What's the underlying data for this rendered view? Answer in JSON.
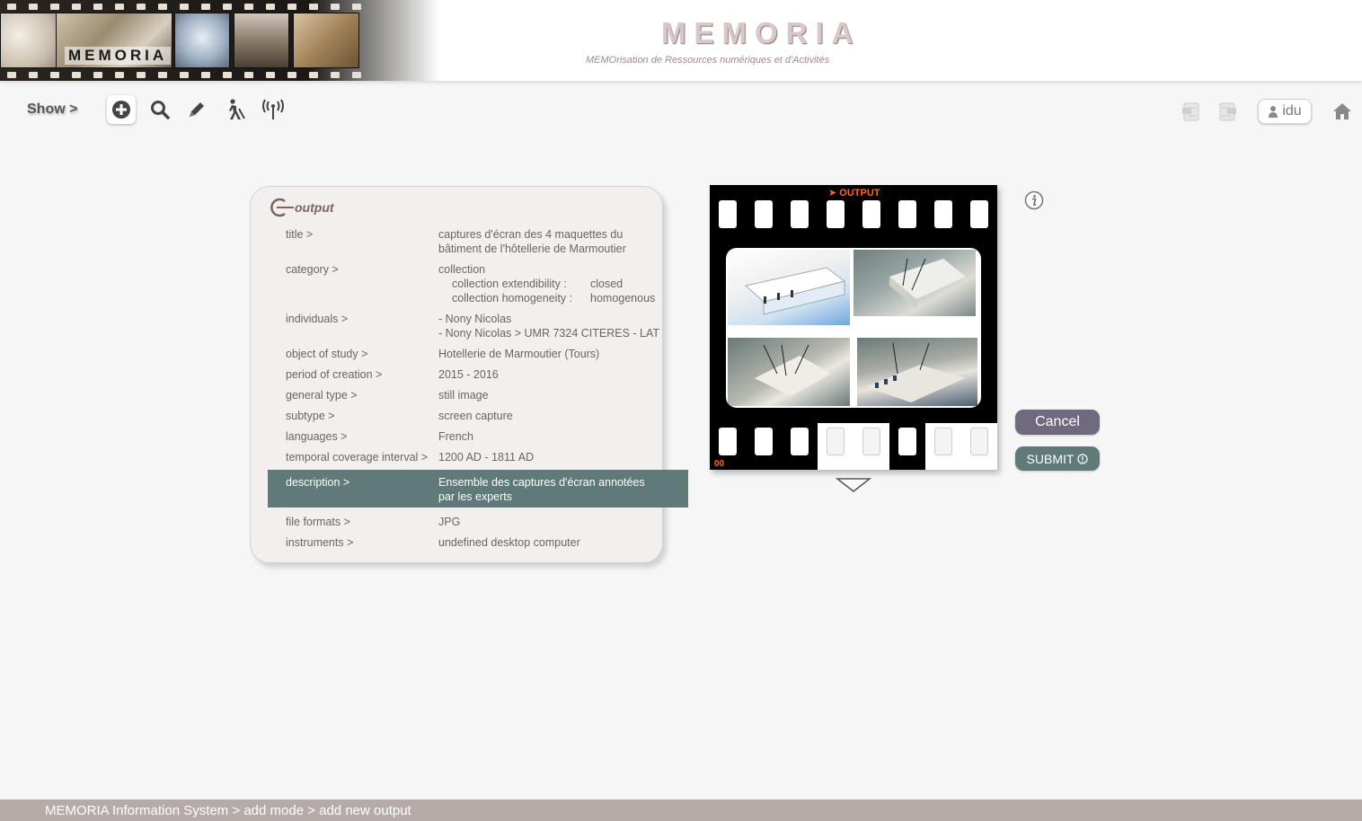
{
  "header": {
    "banner_logo": "MEMORIA",
    "site_title": "MEMORIA",
    "site_subtitle": "MEMOrisation de Ressources numériques et d'Activités"
  },
  "toolbar": {
    "show_label": "Show >",
    "user_label": "idu"
  },
  "card": {
    "title": "output",
    "rows": [
      {
        "label": "title >",
        "value": [
          "captures d'écran des 4 maquettes du",
          "bâtiment de l'hôtellerie de Marmoutier"
        ]
      },
      {
        "label": "category >",
        "value": [
          "collection"
        ],
        "sub": [
          {
            "key": "collection extendibility :",
            "val": "closed"
          },
          {
            "key": "collection homogeneity :",
            "val": "homogenous"
          }
        ]
      },
      {
        "label": "individuals >",
        "value": [
          "- Nony Nicolas",
          "- Nony Nicolas > UMR 7324 CITERES - LAT"
        ]
      },
      {
        "label": "object of study >",
        "value": [
          "Hotellerie de Marmoutier (Tours)"
        ]
      },
      {
        "label": "period of creation >",
        "value": [
          "2015 - 2016"
        ]
      },
      {
        "label": "general type >",
        "value": [
          "still image"
        ]
      },
      {
        "label": "subtype >",
        "value": [
          "screen capture"
        ]
      },
      {
        "label": "languages >",
        "value": [
          "French"
        ]
      },
      {
        "label": "temporal coverage interval >",
        "value": [
          "1200 AD - 1811 AD"
        ]
      },
      {
        "label": "description >",
        "value": [
          "Ensemble des captures d'écran annotées",
          "par les experts"
        ]
      },
      {
        "label": "file formats >",
        "value": [
          "JPG"
        ]
      },
      {
        "label": "instruments >",
        "value": [
          "undefined desktop computer"
        ]
      }
    ]
  },
  "film": {
    "label": "➤ OUTPUT",
    "frame_number": "00"
  },
  "buttons": {
    "cancel": "Cancel",
    "submit": "SUBMIT"
  },
  "footer": {
    "breadcrumb": "MEMORIA  Information System  >  add mode > add new output"
  },
  "colors": {
    "accent_teal": "#5f7a78",
    "accent_purple": "#6f6a80",
    "film_orange": "#ff6a1a",
    "footer": "#b5aba9"
  },
  "icons": [
    "add-icon",
    "search-icon",
    "pencil-icon",
    "walker-icon",
    "antenna-icon",
    "document-icon",
    "user-icon",
    "home-icon",
    "info-icon",
    "chevron-down-icon",
    "output-logo-icon"
  ]
}
